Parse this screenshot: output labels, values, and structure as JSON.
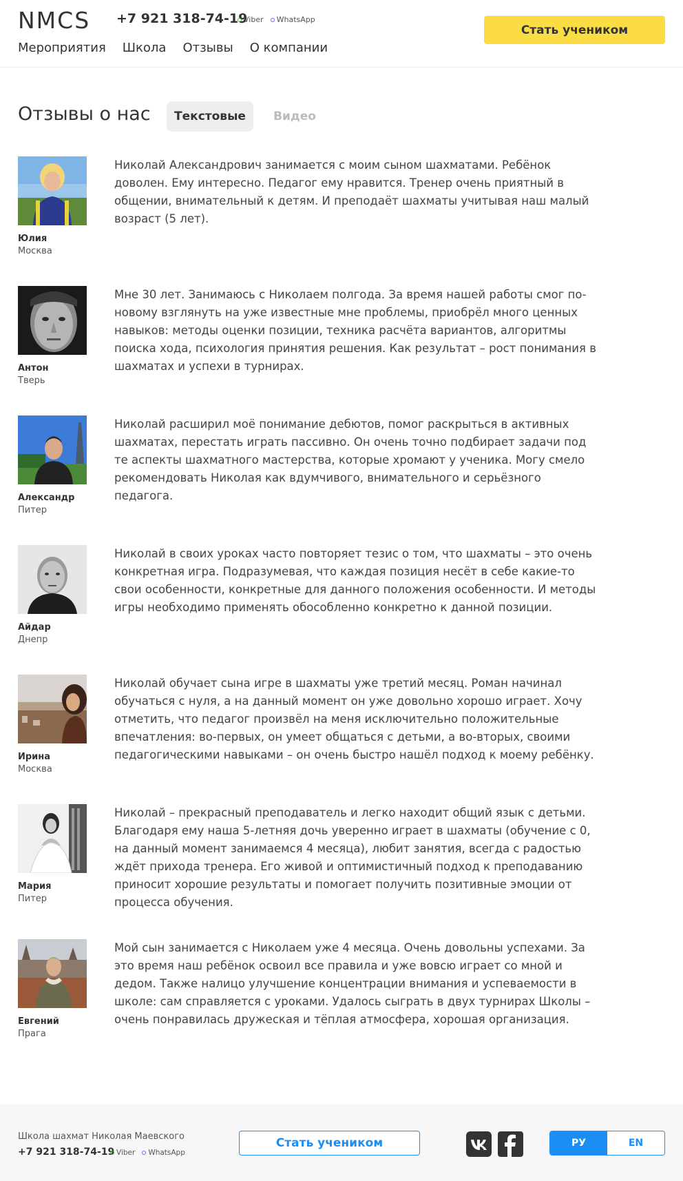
{
  "header": {
    "logo": "NMCS",
    "phone": "+7 921 318-74-19",
    "messengers": [
      {
        "label": "Viber",
        "color": "#2db34a"
      },
      {
        "label": "WhatsApp",
        "color": "#8b5cf6"
      }
    ],
    "nav": [
      "Мероприятия",
      "Школа",
      "Отзывы",
      "О компании"
    ],
    "cta": "Стать учеником"
  },
  "page": {
    "title": "Отзывы о нас",
    "tabs": [
      {
        "label": "Текстовые",
        "active": true
      },
      {
        "label": "Видео",
        "active": false
      }
    ]
  },
  "reviews": [
    {
      "name": "Юлия",
      "city": "Москва",
      "text": "Николай Александрович занимается с моим сыном шахматами. Ребёнок доволен. Ему интересно. Педагог ему нравится. Тренер очень приятный в общении, внимательный к детям. И преподаёт шахматы учитывая наш малый возраст (5 лет)."
    },
    {
      "name": "Антон",
      "city": "Тверь",
      "text": "Мне 30 лет. Занимаюсь с Николаем полгода. За время нашей работы смог по-новому взглянуть на уже известные мне проблемы, приобрёл много ценных навыков: методы оценки позиции, техника расчёта вариантов, алгоритмы поиска хода, психология принятия решения. Как результат – рост понимания в шахматах и успехи в турнирах."
    },
    {
      "name": "Александр",
      "city": "Питер",
      "text": "Николай расширил моё понимание дебютов, помог раскрыться в активных шахматах, перестать играть пассивно. Он очень точно подбирает задачи под те аспекты шахматного мастерства, которые хромают у ученика. Могу смело рекомендовать Николая как вдумчивого, внимательного и серьёзного педагога."
    },
    {
      "name": "Айдар",
      "city": "Днепр",
      "text": "Николай в своих уроках часто повторяет тезис о том, что шахматы – это очень конкретная игра. Подразумевая, что каждая позиция несёт в себе какие-то свои особенности, конкретные для данного положения особенности. И методы игры необходимо применять обособленно конкретно к данной позиции."
    },
    {
      "name": "Ирина",
      "city": "Москва",
      "text": "Николай обучает сына игре в шахматы уже третий месяц. Роман начинал обучаться с нуля, а на данный момент он уже довольно хорошо играет. Хочу отметить, что педагог произвёл на меня исключительно положительные впечатления: во-первых, он умеет общаться с детьми, а во-вторых, своими педагогическими навыками – он очень быстро нашёл подход к моему ребёнку."
    },
    {
      "name": "Мария",
      "city": "Питер",
      "text": "Николай – прекрасный преподаватель и легко находит общий язык с детьми. Благодаря ему наша 5-летняя дочь уверенно играет в шахматы (обучение с 0, на данный момент занимаемся 4 месяца), любит занятия, всегда с радостью ждёт прихода тренера. Его живой и оптимистичный подход к преподаванию приносит хорошие результаты и помогает получить позитивные эмоции от процесса обучения."
    },
    {
      "name": "Евгений",
      "city": "Прага",
      "text": "Мой сын занимается с Николаем уже 4 месяца. Очень довольны успехами. За это время наш ребёнок освоил все правила и уже вовсю играет со мной и дедом. Также налицо улучшение концентрации внимания и успеваемости в школе: сам справляется с уроками. Удалось сыграть в двух турнирах Школы – очень понравилась дружеская и тёплая атмосфера, хорошая организация."
    }
  ],
  "footer": {
    "school": "Школа шахмат Николая Маевского",
    "phone": "+7 921 318-74-19",
    "messengers": [
      {
        "label": "Viber",
        "color": "#2db34a"
      },
      {
        "label": "WhatsApp",
        "color": "#8b5cf6"
      }
    ],
    "cta": "Стать учеником",
    "social": [
      "vk-icon",
      "facebook-icon"
    ],
    "languages": [
      {
        "label": "РУ",
        "active": true
      },
      {
        "label": "EN",
        "active": false
      }
    ]
  }
}
